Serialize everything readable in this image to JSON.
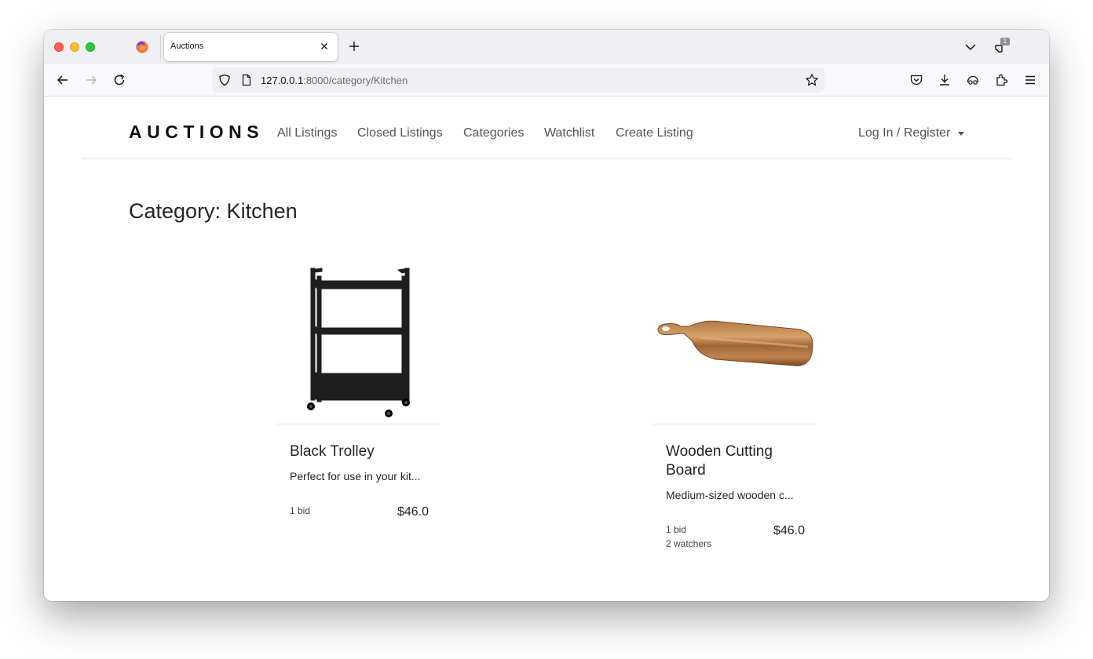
{
  "browser": {
    "tab_title": "Auctions",
    "tab_count": "1",
    "url_host": "127.0.0.1",
    "url_rest": ":8000/category/Kitchen"
  },
  "site": {
    "brand": "AUCTIONS",
    "nav": {
      "all_listings": "All Listings",
      "closed_listings": "Closed Listings",
      "categories": "Categories",
      "watchlist": "Watchlist",
      "create_listing": "Create Listing",
      "login_register": "Log In / Register"
    }
  },
  "page": {
    "heading": "Category: Kitchen",
    "listings": [
      {
        "title": "Black Trolley",
        "description": "Perfect for use in your kit...",
        "bids": "1 bid",
        "watchers": "",
        "price": "$46.0"
      },
      {
        "title": "Wooden Cutting Board",
        "description": "Medium-sized wooden c...",
        "bids": "1 bid",
        "watchers": "2 watchers",
        "price": "$46.0"
      }
    ]
  }
}
